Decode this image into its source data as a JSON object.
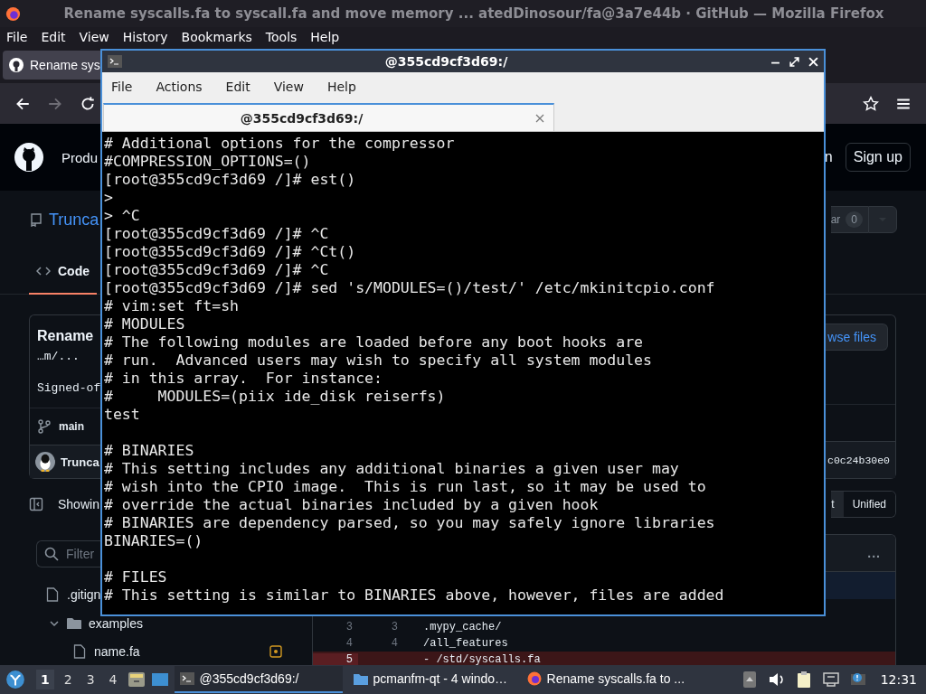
{
  "browser": {
    "title": "Rename syscalls.fa to syscall.fa and move memory ... atedDinosour/fa@3a7e44b · GitHub — Mozilla Firefox",
    "menu": [
      "File",
      "Edit",
      "View",
      "History",
      "Bookmarks",
      "Tools",
      "Help"
    ],
    "tab": {
      "label": "Rename sys"
    },
    "nav": {
      "back_disabled": false,
      "forward_disabled": true
    }
  },
  "github": {
    "header": {
      "left": "Produ",
      "right": "n",
      "signup": "Sign up"
    },
    "repo": {
      "name": "Trunca",
      "star": "ar",
      "star_count": "0"
    },
    "tabs": [
      {
        "label": "Code",
        "selected": true
      }
    ],
    "commit": {
      "title": "Rename",
      "body": "…m/...",
      "signed": "Signed-of",
      "branch": "main",
      "author": "Trunca",
      "sha": "c0c24b30e0",
      "browse": "wse files"
    },
    "view": {
      "showing": "Showin",
      "toggle": [
        {
          "label": "t",
          "selected": false
        },
        {
          "label": "Unified",
          "selected": true
        }
      ]
    },
    "filter": {
      "placeholder": "Filter"
    },
    "tree": [
      {
        "kind": "file",
        "name": ".gitign"
      },
      {
        "kind": "folder",
        "name": "examples",
        "expanded": true,
        "children": [
          {
            "kind": "file",
            "name": "name.fa",
            "modified": true
          }
        ]
      }
    ],
    "diff": {
      "menu": "...",
      "rows": [
        {
          "kind": "context",
          "old": "3",
          "new": "3",
          "text": ".mypy_cache/"
        },
        {
          "kind": "context",
          "old": "4",
          "new": "4",
          "text": "/all_features"
        },
        {
          "kind": "removed",
          "old": "5",
          "new": "",
          "text": "- /std/syscalls.fa"
        }
      ]
    }
  },
  "terminal": {
    "title": "@355cd9cf3d69:/",
    "menu": [
      "File",
      "Actions",
      "Edit",
      "View",
      "Help"
    ],
    "tab": {
      "label": "@355cd9cf3d69:/"
    },
    "blocks": [
      [
        "# Additional options for the compressor",
        "#COMPRESSION_OPTIONS=()",
        "[root@355cd9cf3d69 /]# est()",
        ">",
        "> ^C",
        "[root@355cd9cf3d69 /]# ^C",
        "[root@355cd9cf3d69 /]# ^Ct()",
        "[root@355cd9cf3d69 /]# ^C",
        "[root@355cd9cf3d69 /]# sed 's/MODULES=()/test/' /etc/mkinitcpio.conf",
        "# vim:set ft=sh",
        "# MODULES",
        "# The following modules are loaded before any boot hooks are",
        "# run.  Advanced users may wish to specify all system modules",
        "# in this array.  For instance:",
        "#     MODULES=(piix ide_disk reiserfs)",
        "test"
      ],
      [
        "# BINARIES",
        "# This setting includes any additional binaries a given user may",
        "# wish into the CPIO image.  This is run last, so it may be used to",
        "# override the actual binaries included by a given hook",
        "# BINARIES are dependency parsed, so you may safely ignore libraries",
        "BINARIES=()"
      ],
      [
        "# FILES",
        "# This setting is similar to BINARIES above, however, files are added"
      ]
    ]
  },
  "taskbar": {
    "workspaces": [
      {
        "label": "1",
        "selected": true
      },
      {
        "label": "2",
        "selected": false
      },
      {
        "label": "3",
        "selected": false
      },
      {
        "label": "4",
        "selected": false
      }
    ],
    "tasks": [
      {
        "kind": "terminal",
        "label": "@355cd9cf3d69:/",
        "selected": true
      },
      {
        "kind": "folder",
        "label": "pcmanfm-qt - 4 windo…",
        "selected": false
      },
      {
        "kind": "browser",
        "label": "Rename syscalls.fa to ...",
        "selected": false
      }
    ],
    "clock": "12:31"
  }
}
